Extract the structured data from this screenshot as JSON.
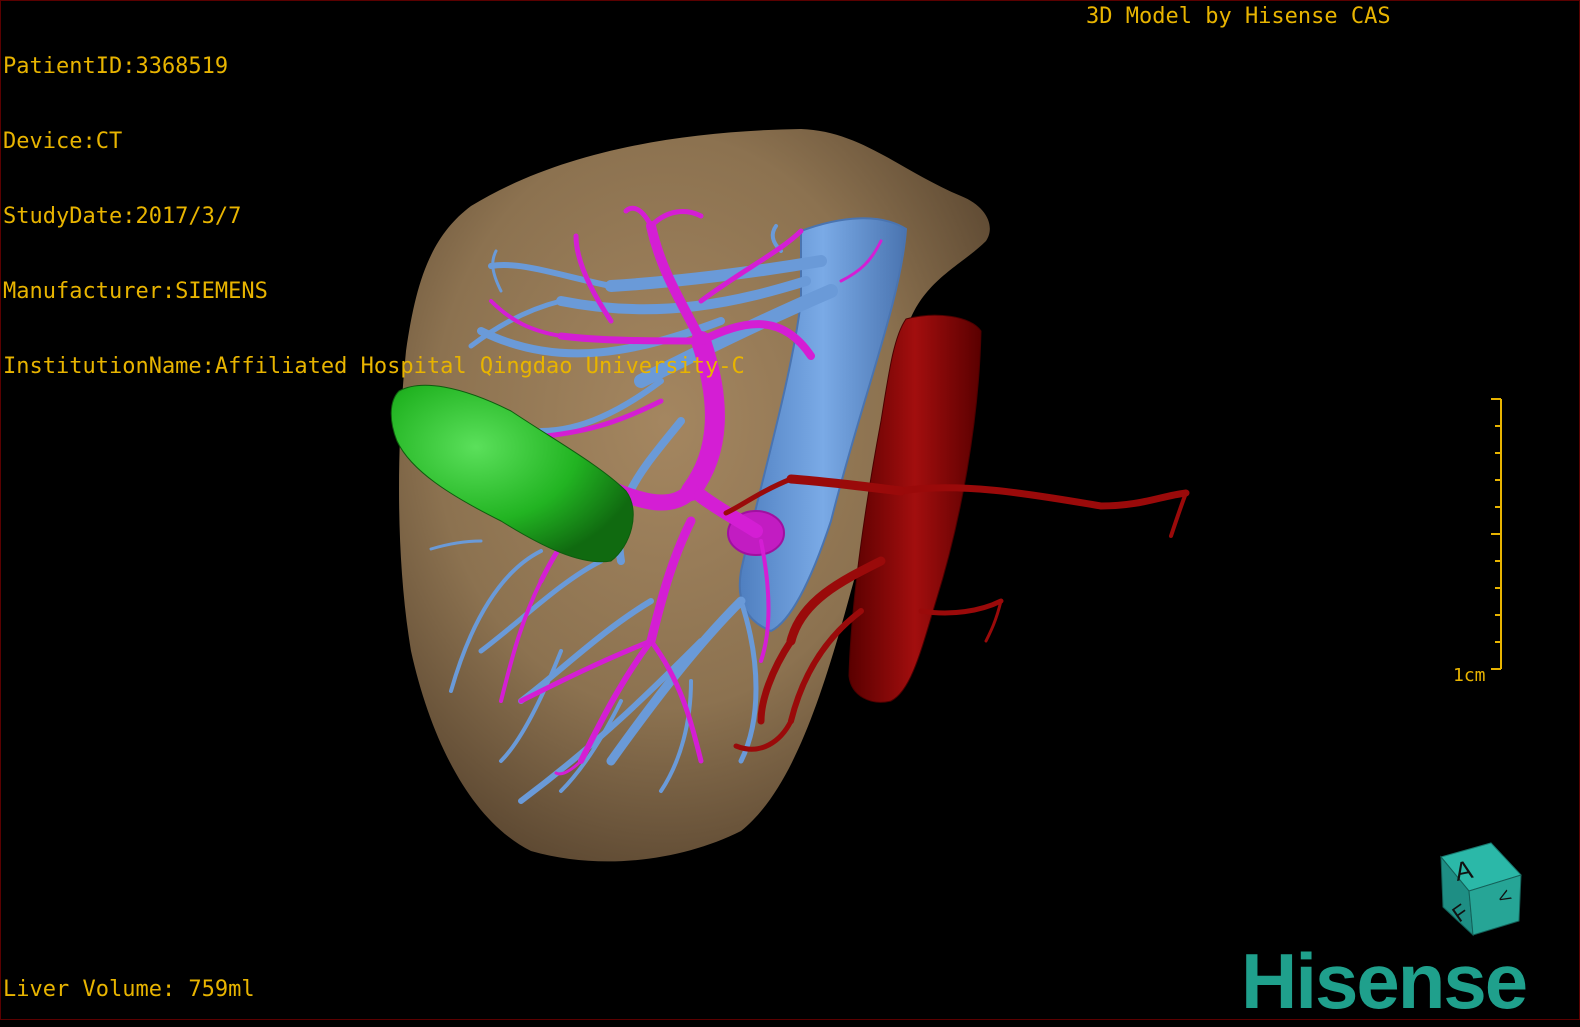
{
  "header": {
    "patient_id": "PatientID:3368519",
    "device": "Device:CT",
    "study_date": "StudyDate:2017/3/7",
    "manufacturer": "Manufacturer:SIEMENS",
    "institution": "InstitutionName:Affiliated Hospital Qingdao University-C",
    "model_credit": "3D Model by Hisense CAS"
  },
  "footer": {
    "liver_volume": "Liver Volume: 759ml"
  },
  "scale": {
    "label": "1cm"
  },
  "orientation_cube": {
    "face_front": "A",
    "face_bottom": "F",
    "face_side": "V"
  },
  "brand": {
    "logo_text": "Hisense"
  },
  "colors": {
    "overlay_text": "#e8b400",
    "liver": "#8c7250",
    "portal_vein": "#d41ed4",
    "hepatic_vein": "#6a9ad8",
    "gallbladder": "#22b422",
    "artery_aorta": "#8a0000",
    "brand": "#1fa08c"
  }
}
